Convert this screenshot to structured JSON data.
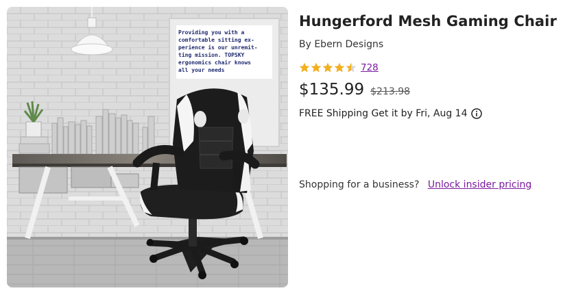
{
  "product": {
    "title": "Hungerford Mesh Gaming Chair",
    "brand": "By Ebern Designs",
    "rating": 4.5,
    "review_count": "728",
    "price": "$135.99",
    "was_price": "$213.98",
    "shipping": "FREE Shipping Get it by Fri, Aug 14"
  },
  "business": {
    "prompt": "Shopping for a business?",
    "link": "Unlock insider pricing"
  },
  "image": {
    "poster_lines": [
      "Providing you with a",
      "comfortable sitting ex-",
      "perience is our unremit-",
      "ting mission. TOPSKY",
      "ergonomics chair knows",
      "all your needs"
    ]
  },
  "icons": {
    "star": "star-icon",
    "info": "info-icon"
  },
  "colors": {
    "star": "#f2b01e",
    "link": "#7b189f"
  }
}
